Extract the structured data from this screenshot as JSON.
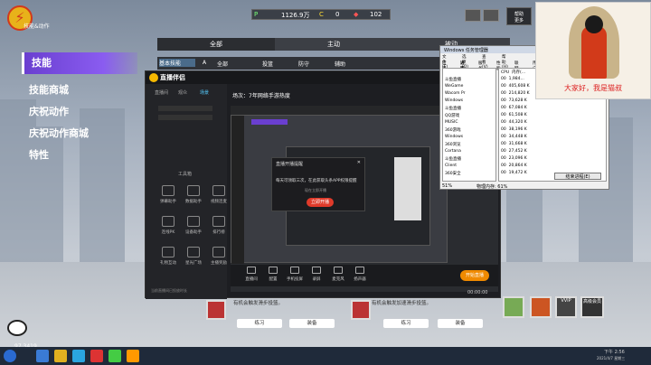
{
  "game": {
    "logo_text": "技能&动作",
    "sidebar": [
      {
        "label": "技能",
        "active": true
      },
      {
        "label": "技能商城",
        "active": false
      },
      {
        "label": "庆祝动作",
        "active": false
      },
      {
        "label": "庆祝动作商城",
        "active": false
      },
      {
        "label": "特性",
        "active": false
      }
    ],
    "stats": {
      "p_value": "1126.9万",
      "c_value": "0",
      "gem_value": "102"
    },
    "help_label": "帮助\n更多",
    "tabs": [
      "全部",
      "主动",
      "被动"
    ],
    "subbar": {
      "basic": "基本技能",
      "a_label": "全部",
      "items": [
        "投篮",
        "防守",
        "辅助"
      ]
    },
    "practice_label": "练习",
    "equip_label": "装备",
    "row_text_1": "有机会触发滑步投篮。",
    "row_text_2": "有机会触发加速滑步投篮。",
    "vip_label": "VVIP",
    "pack_label": "高级会员",
    "footer_number": "97.3419"
  },
  "live_app": {
    "brand": "直播伴侣",
    "left_tabs": [
      "直播间",
      "观众",
      "场景"
    ],
    "title_prefix": "场次：",
    "title": "7年网络手游热度",
    "tools_label": "工具箱",
    "tools": [
      "弹幕助手",
      "数据助手",
      "视频连麦",
      "连线PK",
      "设备助手",
      "排行榜",
      "礼物互动",
      "星光广场",
      "主播奖励"
    ],
    "bottom_buttons": [
      "直播间",
      "配置",
      "手机投屏",
      "录屏",
      "麦克风",
      "扬声器"
    ],
    "start_label": "开始直播",
    "time": "00:00:00",
    "status": "当前直播间已投放时长"
  },
  "dialog": {
    "title": "直播开播提醒",
    "body": "每天可领取三次，在此获取头条APP权限提醒",
    "sub": "现在立即开播",
    "confirm": "立即开播"
  },
  "taskmgr": {
    "title": "Windows 任务管理器",
    "menu": [
      "文件(F)",
      "选项(O)",
      "查看(V)",
      "帮助(H)"
    ],
    "tabs": [
      "应用程序",
      "进程",
      "服务",
      "性能",
      "联网",
      "用户"
    ],
    "columns": [
      "CPU",
      "内存(..."
    ],
    "rows": [
      {
        "cpu": "00",
        "mem": "1,984..."
      },
      {
        "cpu": "00",
        "mem": "405,608 K"
      },
      {
        "cpu": "00",
        "mem": "214,820 K"
      },
      {
        "cpu": "00",
        "mem": "73,628 K"
      },
      {
        "cpu": "00",
        "mem": "67,084 K"
      },
      {
        "cpu": "00",
        "mem": "61,508 K"
      },
      {
        "cpu": "00",
        "mem": "44,320 K"
      },
      {
        "cpu": "00",
        "mem": "38,196 K"
      },
      {
        "cpu": "00",
        "mem": "34,448 K"
      },
      {
        "cpu": "00",
        "mem": "31,668 K"
      },
      {
        "cpu": "00",
        "mem": "27,452 K"
      },
      {
        "cpu": "00",
        "mem": "23,096 K"
      },
      {
        "cpu": "00",
        "mem": "20,864 K"
      },
      {
        "cpu": "00",
        "mem": "19,472 K"
      }
    ],
    "names": [
      "斗鱼直播",
      "WeGame",
      "Wacom Pr",
      "Windows",
      "斗鱼直播",
      "QQ游戏",
      "MUSIC",
      "360游戏",
      "Windows",
      "360浏览",
      "Cortana",
      "斗鱼直播",
      "Client",
      "360安全"
    ],
    "footer_cpu": "51%",
    "footer_mem": "物理内存: 61%",
    "end_button": "结束进程(E)"
  },
  "streamer": {
    "caption": "大家好，我是猫叔"
  },
  "taskbar": {
    "time": "下午 2:56",
    "date": "2021/4/7 星期三"
  }
}
